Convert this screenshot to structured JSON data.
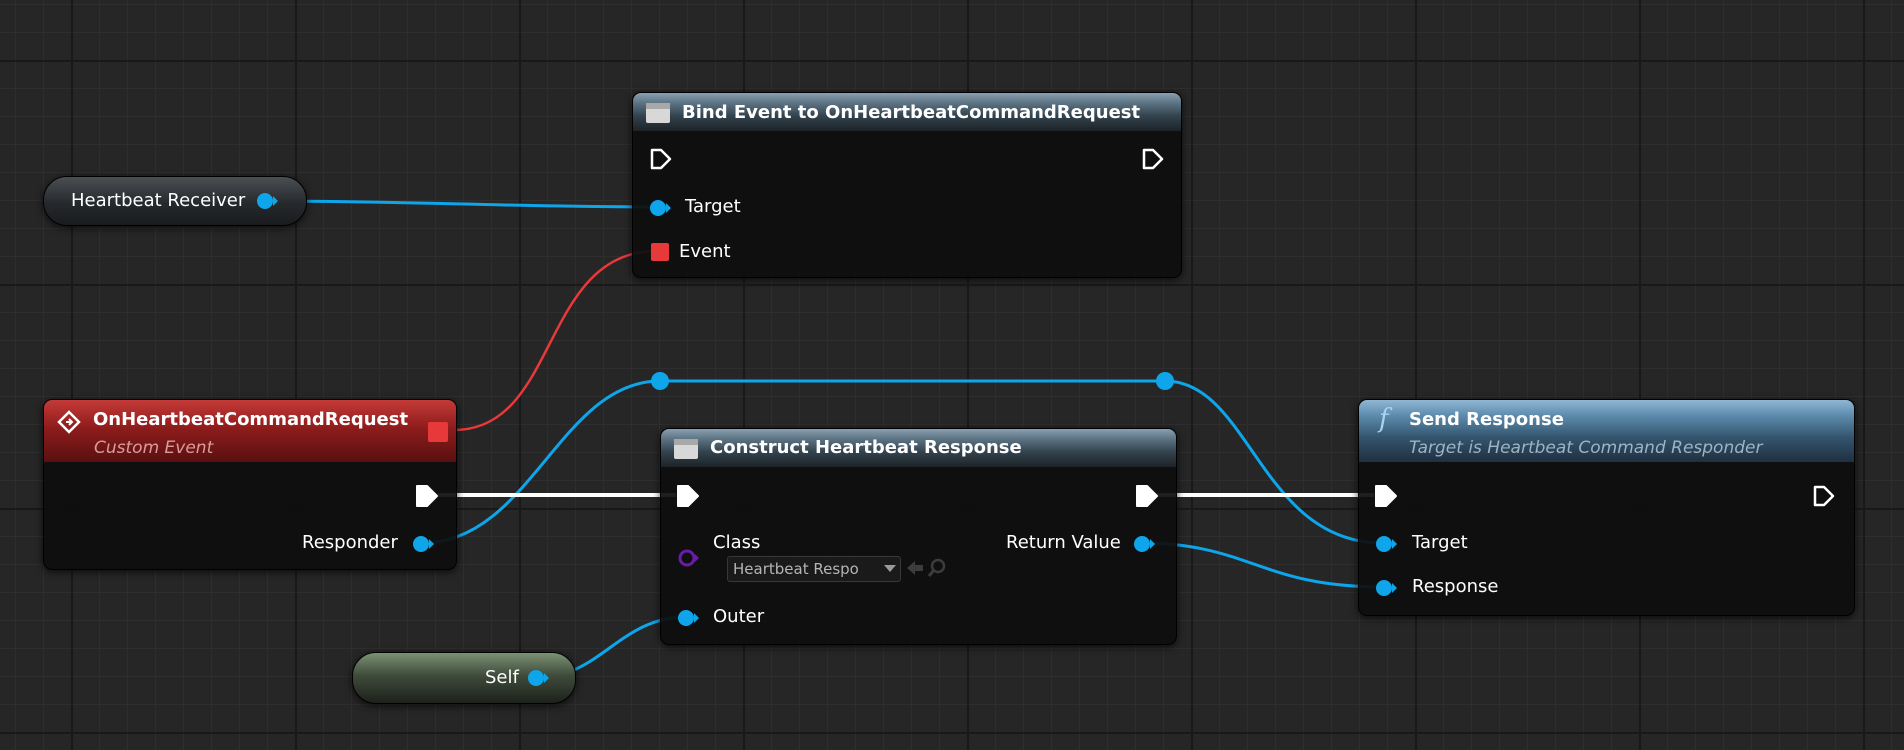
{
  "graph": {
    "bind_node": {
      "title": "Bind Event to OnHeartbeatCommandRequest",
      "pin_target": "Target",
      "pin_event": "Event"
    },
    "heartbeat_receiver_var": {
      "label": "Heartbeat Receiver"
    },
    "custom_event_node": {
      "title": "OnHeartbeatCommandRequest",
      "subtitle": "Custom Event",
      "pin_responder": "Responder"
    },
    "construct_node": {
      "title": "Construct Heartbeat Response",
      "pin_class": "Class",
      "class_value": "Heartbeat Respo",
      "pin_return": "Return Value",
      "pin_outer": "Outer"
    },
    "self_var": {
      "label": "Self"
    },
    "send_response_node": {
      "title": "Send Response",
      "subtitle": "Target is Heartbeat Command Responder",
      "pin_target": "Target",
      "pin_response": "Response"
    }
  },
  "colors": {
    "object_pin": "#0ea5ea",
    "delegate_pin": "#e8393a",
    "exec_wire": "#ffffff",
    "class_pin": "#6a1ba8"
  },
  "icons": {
    "function_icon": "f",
    "custom_event_icon": "diamond-icon"
  }
}
